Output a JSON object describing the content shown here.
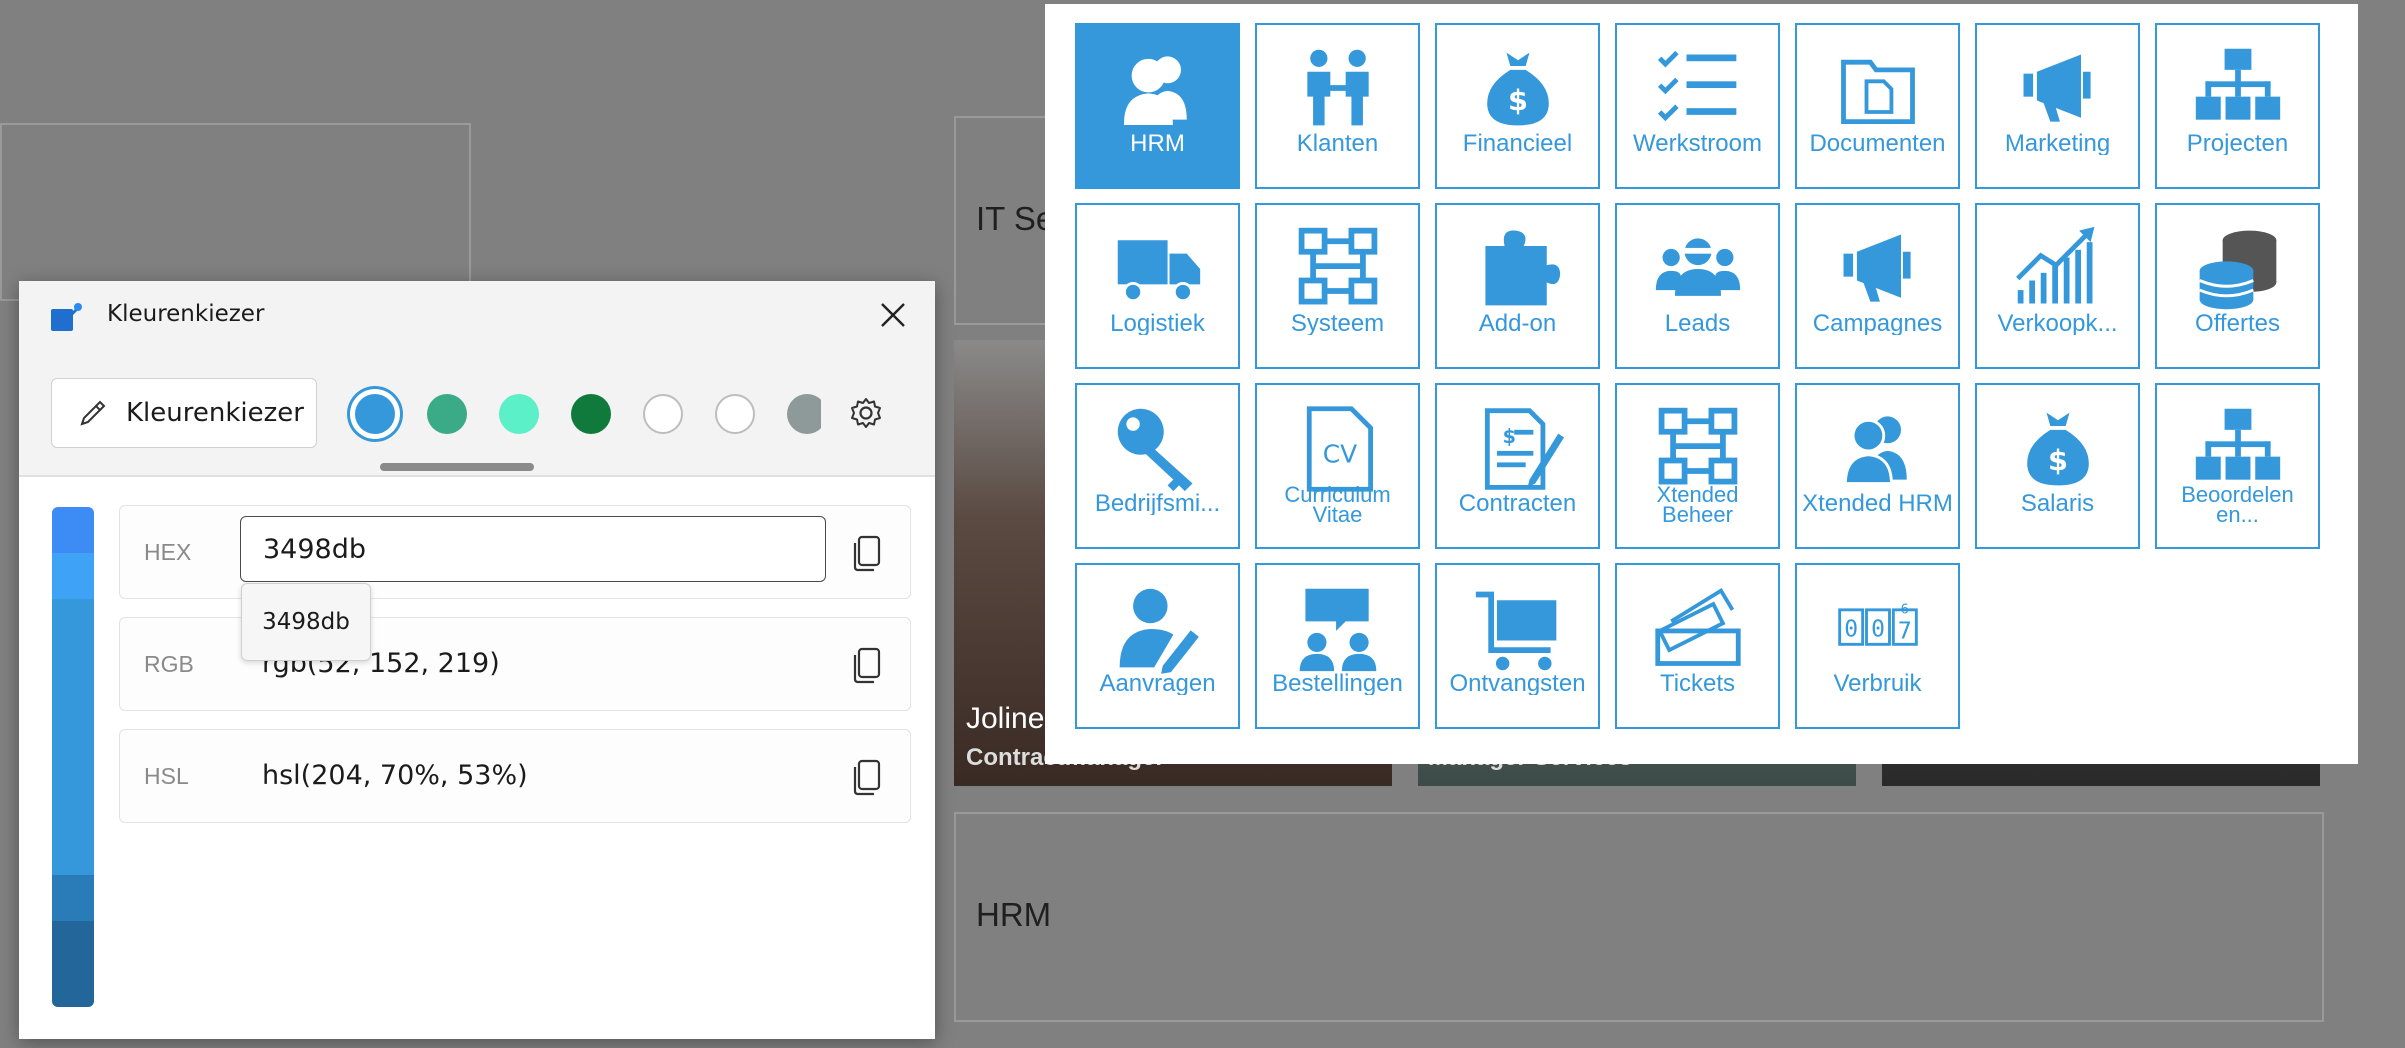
{
  "background": {
    "cards": [
      {
        "label": ""
      },
      {
        "label": "IT Se"
      },
      {
        "label": "HRM"
      }
    ],
    "people": [
      {
        "name": "Joline",
        "role": "Contractmanager"
      },
      {
        "name": "",
        "role": "Manager Services"
      },
      {
        "name": "",
        "role": ""
      }
    ]
  },
  "app_menu": {
    "tiles": [
      {
        "label": "HRM",
        "icon": "users-icon",
        "active": true
      },
      {
        "label": "Klanten",
        "icon": "handshake-people-icon"
      },
      {
        "label": "Financieel",
        "icon": "money-bag-icon"
      },
      {
        "label": "Werkstroom",
        "icon": "checklist-icon"
      },
      {
        "label": "Documenten",
        "icon": "folder-icon"
      },
      {
        "label": "Marketing",
        "icon": "megaphone-icon"
      },
      {
        "label": "Projecten",
        "icon": "sitemap-icon"
      },
      {
        "label": "Logistiek",
        "icon": "truck-icon"
      },
      {
        "label": "Systeem",
        "icon": "network-icon"
      },
      {
        "label": "Add-on",
        "icon": "puzzle-icon"
      },
      {
        "label": "Leads",
        "icon": "group-icon"
      },
      {
        "label": "Campagnes",
        "icon": "megaphone-icon"
      },
      {
        "label": "Verkoopk...",
        "icon": "chart-up-icon"
      },
      {
        "label": "Offertes",
        "icon": "coins-icon"
      },
      {
        "label": "Bedrijfsmi...",
        "icon": "key-icon"
      },
      {
        "label": "Curriculum Vitae",
        "icon": "cv-file-icon"
      },
      {
        "label": "Contracten",
        "icon": "contract-icon"
      },
      {
        "label": "Xtended Beheer",
        "icon": "network-icon"
      },
      {
        "label": "Xtended HRM",
        "icon": "users-icon"
      },
      {
        "label": "Salaris",
        "icon": "money-bag-icon"
      },
      {
        "label": "Beoordelen en...",
        "icon": "sitemap-icon"
      },
      {
        "label": "Aanvragen",
        "icon": "user-edit-icon"
      },
      {
        "label": "Bestellingen",
        "icon": "chat-users-icon"
      },
      {
        "label": "Ontvangsten",
        "icon": "cart-icon"
      },
      {
        "label": "Tickets",
        "icon": "ticket-icon"
      },
      {
        "label": "Verbruik",
        "icon": "counter-icon"
      }
    ]
  },
  "color_picker": {
    "title": "Kleurenkiezer",
    "eyedropper_label": "Kleurenkiezer",
    "swatches": [
      "#3498db",
      "#3aab86",
      "#5cf0c8",
      "#0f7a3c",
      "#ffffff",
      "#ffffff",
      "#8e9a9a"
    ],
    "gradient": [
      "#3d8cf5",
      "#3ea3f5",
      "#3498db",
      "#3498db",
      "#2a7cb8",
      "#23679a"
    ],
    "hex_label": "HEX",
    "hex_value": "3498db",
    "hex_tooltip": "3498db",
    "rgb_label": "RGB",
    "rgb_value": "rgb(52, 152, 219)",
    "hsl_label": "HSL",
    "hsl_value": "hsl(204, 70%, 53%)"
  }
}
